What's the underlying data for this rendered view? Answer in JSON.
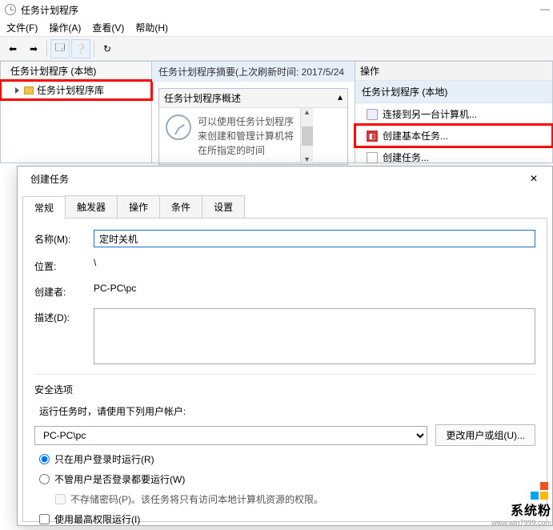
{
  "window_title": "任务计划程序",
  "menu": {
    "file": "文件(F)",
    "action": "操作(A)",
    "view": "查看(V)",
    "help": "帮助(H)"
  },
  "tree": {
    "header": "任务计划程序 (本地)",
    "lib": "任务计划程序库"
  },
  "summary": {
    "bar": "任务计划程序摘要(上次刷新时间: 2017/5/24",
    "box_header": "任务计划程序概述",
    "text": "可以使用任务计划程序来创建和管理计算机将在所指定的时间"
  },
  "actions": {
    "header": "操作",
    "section": "任务计划程序 (本地)",
    "a1": "连接到另一台计算机...",
    "a2": "创建基本任务...",
    "a3": "创建任务..."
  },
  "dialog": {
    "title": "创建任务",
    "tabs": {
      "general": "常规",
      "triggers": "触发器",
      "actions": "操作",
      "conditions": "条件",
      "settings": "设置"
    },
    "name_label": "名称(M):",
    "name_value": "定时关机",
    "location_label": "位置:",
    "location_value": "\\",
    "author_label": "创建者:",
    "author_value": "PC-PC\\pc",
    "desc_label": "描述(D):",
    "security_header": "安全选项",
    "security_hint": "运行任务时，请使用下列用户帐户:",
    "account": "PC-PC\\pc",
    "change_user": "更改用户或组(U)...",
    "r1": "只在用户登录时运行(R)",
    "r2": "不管用户是否登录都要运行(W)",
    "no_pw": "不存储密码(P)。该任务将只有访问本地计算机资源的权限。",
    "highest": "使用最高权限运行(I)"
  },
  "watermark": {
    "brand": "系统粉",
    "url": "www.win7999.com"
  }
}
